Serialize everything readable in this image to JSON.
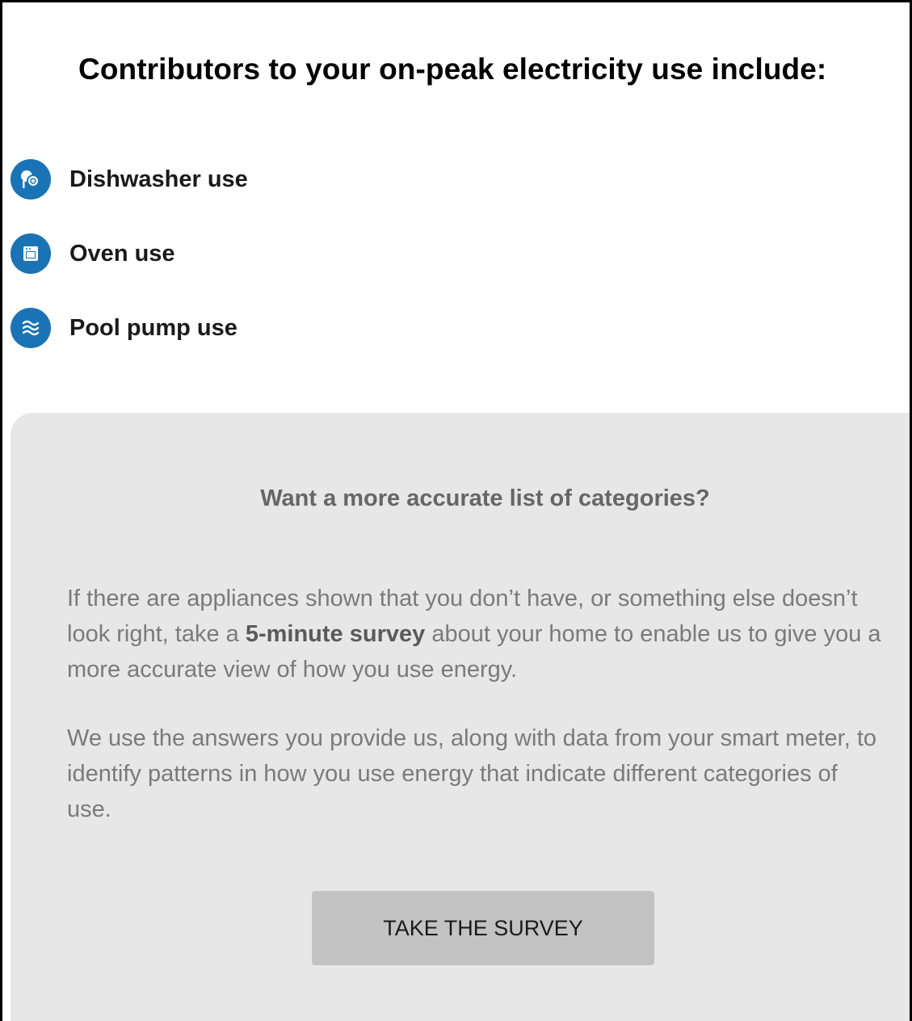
{
  "header": {
    "title": "Contributors to your on-peak electricity use include:"
  },
  "contributors": [
    {
      "label": "Dishwasher use",
      "icon": "dishwasher-icon"
    },
    {
      "label": "Oven use",
      "icon": "oven-icon"
    },
    {
      "label": "Pool pump use",
      "icon": "pool-pump-icon"
    }
  ],
  "survey": {
    "heading": "Want a more accurate list of categories?",
    "para1_before": "If there are appliances shown that you don’t have, or something else doesn’t look right, take a ",
    "para1_bold": "5-minute survey",
    "para1_after": " about your home to enable us to give you a more accurate view of how you use energy.",
    "para2": "We use the answers you provide us, along with data from your smart meter, to identify patterns in how you use energy that indicate different categories of use.",
    "button_label": "TAKE THE SURVEY"
  },
  "colors": {
    "icon_blue": "#1a73b4",
    "panel_bg": "#e7e7e7",
    "button_bg": "#c2c2c2"
  }
}
